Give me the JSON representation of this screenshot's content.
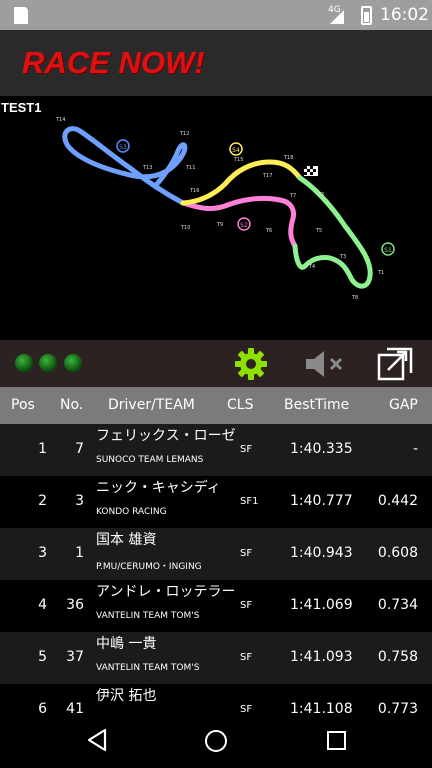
{
  "status_bar": {
    "network": "4G",
    "time": "16:02"
  },
  "app": {
    "logo_text": "RACE NOW!"
  },
  "map": {
    "session_title": "TEST1",
    "sector_labels": [
      "S1",
      "S2",
      "S3",
      "S4"
    ],
    "turn_labels": [
      "T1",
      "T2",
      "T3",
      "T4",
      "T5",
      "T6",
      "T7",
      "T8",
      "T9",
      "T10",
      "T11",
      "T12",
      "T13",
      "T14",
      "T15",
      "T16",
      "T17",
      "T18"
    ],
    "sector_colors": {
      "S1": "#7be07b",
      "S2": "#ff7bd0",
      "S3": "#5a8cff",
      "S4": "#ffee55"
    }
  },
  "controls": {
    "lights": [
      "green",
      "green",
      "green"
    ],
    "settings_icon": "gear-icon",
    "mute_icon": "volume-off-icon",
    "expand_icon": "expand-icon"
  },
  "table": {
    "headers": {
      "pos": "Pos",
      "no": "No.",
      "driver": "Driver/TEAM",
      "cls": "CLS",
      "best": "BestTime",
      "gap": "GAP"
    },
    "rows": [
      {
        "pos": "1",
        "no": "7",
        "driver": "フェリックス・ローゼ",
        "team": "SUNOCO TEAM LEMANS",
        "cls": "SF",
        "best": "1:40.335",
        "gap": "-"
      },
      {
        "pos": "2",
        "no": "3",
        "driver": "ニック・キャシディ",
        "team": "KONDO RACING",
        "cls": "SF1",
        "best": "1:40.777",
        "gap": "0.442"
      },
      {
        "pos": "3",
        "no": "1",
        "driver": "国本 雄資",
        "team": "P.MU/CERUMO・INGING",
        "cls": "SF",
        "best": "1:40.943",
        "gap": "0.608"
      },
      {
        "pos": "4",
        "no": "36",
        "driver": "アンドレ・ロッテラー",
        "team": "VANTELIN TEAM TOM'S",
        "cls": "SF",
        "best": "1:41.069",
        "gap": "0.734"
      },
      {
        "pos": "5",
        "no": "37",
        "driver": "中嶋 一貴",
        "team": "VANTELIN TEAM TOM'S",
        "cls": "SF",
        "best": "1:41.093",
        "gap": "0.758"
      },
      {
        "pos": "6",
        "no": "41",
        "driver": "伊沢 拓也",
        "team": "",
        "cls": "SF",
        "best": "1:41.108",
        "gap": "0.773"
      }
    ]
  },
  "navbar": {
    "back_icon": "back-icon",
    "home_icon": "home-icon",
    "recent_icon": "recent-apps-icon"
  }
}
